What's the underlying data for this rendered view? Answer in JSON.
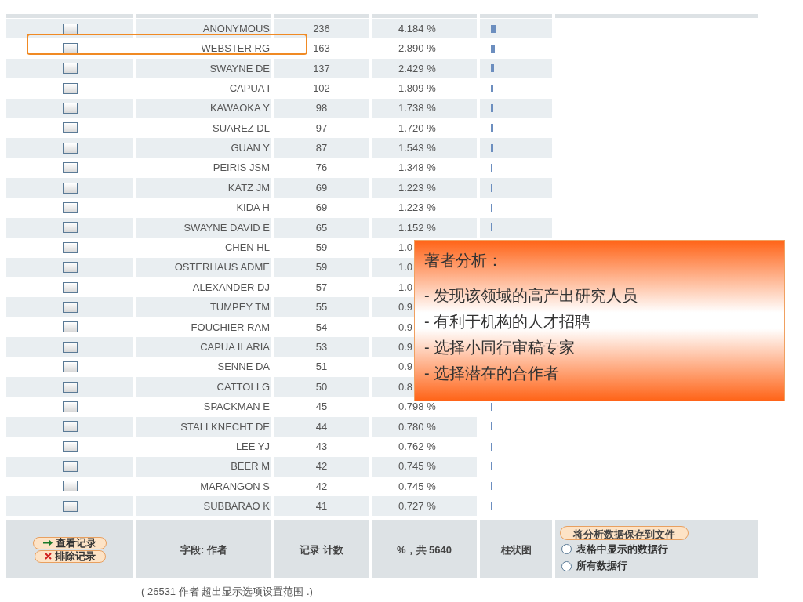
{
  "rows": [
    {
      "checked": false,
      "name": "ANONYMOUS",
      "count": "236",
      "percent": "4.184 %",
      "highlighted": false
    },
    {
      "checked": false,
      "name": "WEBSTER RG",
      "count": "163",
      "percent": "2.890 %",
      "highlighted": true
    },
    {
      "checked": false,
      "name": "SWAYNE DE",
      "count": "137",
      "percent": "2.429 %",
      "highlighted": false
    },
    {
      "checked": false,
      "name": "CAPUA I",
      "count": "102",
      "percent": "1.809 %",
      "highlighted": false
    },
    {
      "checked": false,
      "name": "KAWAOKA Y",
      "count": "98",
      "percent": "1.738 %",
      "highlighted": false
    },
    {
      "checked": false,
      "name": "SUAREZ DL",
      "count": "97",
      "percent": "1.720 %",
      "highlighted": false
    },
    {
      "checked": false,
      "name": "GUAN Y",
      "count": "87",
      "percent": "1.543 %",
      "highlighted": false
    },
    {
      "checked": false,
      "name": "PEIRIS JSM",
      "count": "76",
      "percent": "1.348 %",
      "highlighted": false
    },
    {
      "checked": false,
      "name": "KATZ JM",
      "count": "69",
      "percent": "1.223 %",
      "highlighted": false
    },
    {
      "checked": false,
      "name": "KIDA H",
      "count": "69",
      "percent": "1.223 %",
      "highlighted": false
    },
    {
      "checked": false,
      "name": "SWAYNE DAVID E",
      "count": "65",
      "percent": "1.152 %",
      "highlighted": false
    },
    {
      "checked": false,
      "name": "CHEN HL",
      "count": "59",
      "percent": "1.0",
      "highlighted": false
    },
    {
      "checked": false,
      "name": "OSTERHAUS ADME",
      "count": "59",
      "percent": "1.0",
      "highlighted": false
    },
    {
      "checked": false,
      "name": "ALEXANDER DJ",
      "count": "57",
      "percent": "1.0",
      "highlighted": false
    },
    {
      "checked": false,
      "name": "TUMPEY TM",
      "count": "55",
      "percent": "0.9",
      "highlighted": false
    },
    {
      "checked": false,
      "name": "FOUCHIER RAM",
      "count": "54",
      "percent": "0.9",
      "highlighted": false
    },
    {
      "checked": false,
      "name": "CAPUA ILARIA",
      "count": "53",
      "percent": "0.9",
      "highlighted": false
    },
    {
      "checked": false,
      "name": "SENNE DA",
      "count": "51",
      "percent": "0.9",
      "highlighted": false
    },
    {
      "checked": false,
      "name": "CATTOLI G",
      "count": "50",
      "percent": "0.8",
      "highlighted": false
    },
    {
      "checked": false,
      "name": "SPACKMAN E",
      "count": "45",
      "percent": "0.798 %",
      "highlighted": false
    },
    {
      "checked": false,
      "name": "STALLKNECHT DE",
      "count": "44",
      "percent": "0.780 %",
      "highlighted": false
    },
    {
      "checked": false,
      "name": "LEE YJ",
      "count": "43",
      "percent": "0.762 %",
      "highlighted": false
    },
    {
      "checked": false,
      "name": "BEER M",
      "count": "42",
      "percent": "0.745 %",
      "highlighted": false
    },
    {
      "checked": false,
      "name": "MARANGON S",
      "count": "42",
      "percent": "0.745 %",
      "highlighted": false
    },
    {
      "checked": false,
      "name": "SUBBARAO K",
      "count": "41",
      "percent": "0.727 %",
      "highlighted": false
    }
  ],
  "footer": {
    "view_button": "查看记录",
    "exclude_button": "排除记录",
    "field_label": "字段: 作者",
    "count_label": "记录 计数",
    "percent_label": "%，共 5640",
    "bar_label": "柱状图",
    "save_button": "将分析数据保存到文件",
    "options": [
      {
        "label": "表格中显示的数据行",
        "selected": false
      },
      {
        "label": "所有数据行",
        "selected": false
      }
    ]
  },
  "note": "( 26531 作者  超出显示选项设置范围 .)",
  "callout": {
    "title": "著者分析：",
    "lines": [
      "- 发现该领域的高产出研究人员",
      "- 有利于机构的人才招聘",
      "- 选择小同行审稿专家",
      "- 选择潜在的合作者"
    ]
  }
}
